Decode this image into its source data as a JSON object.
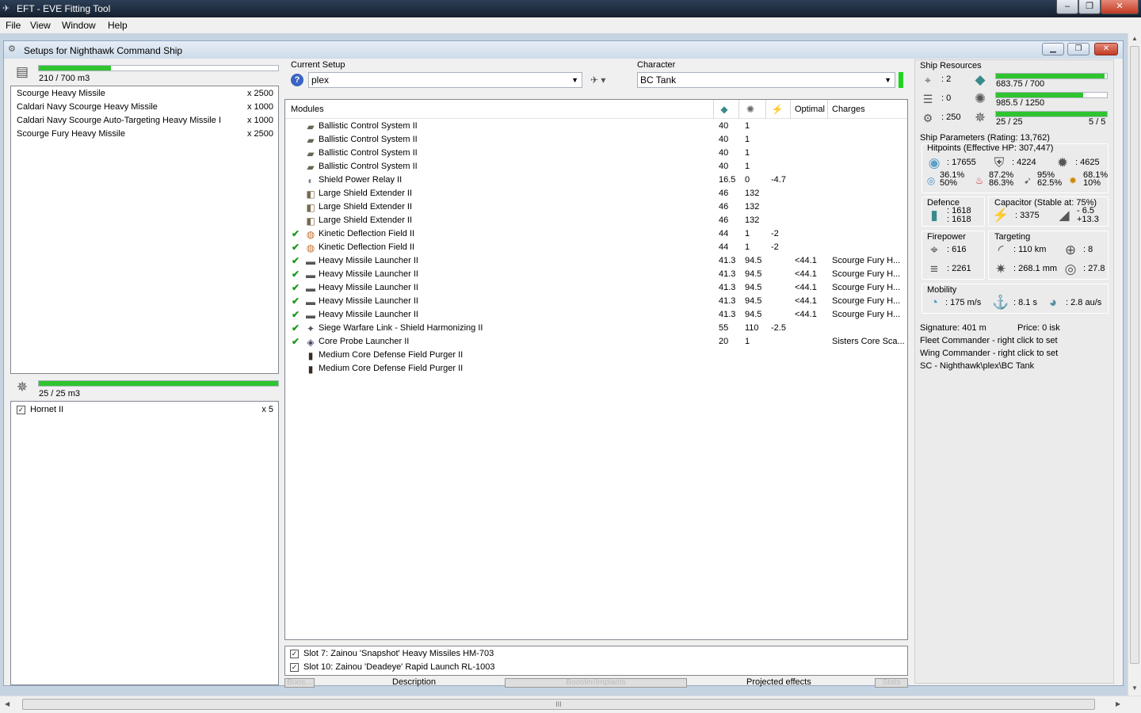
{
  "window": {
    "title": "EFT - EVE Fitting Tool",
    "minimize": "–",
    "maximize": "❐",
    "close": "✕"
  },
  "menu": [
    "File",
    "View",
    "Window",
    "Help"
  ],
  "inner": {
    "title": "Setups for Nighthawk Command Ship"
  },
  "cargo": {
    "capacity": "210 / 700 m3",
    "fill": 0.3,
    "items": [
      {
        "name": "Scourge Heavy Missile",
        "qty": "x 2500"
      },
      {
        "name": "Caldari Navy Scourge Heavy Missile",
        "qty": "x 1000"
      },
      {
        "name": "Caldari Navy Scourge Auto-Targeting Heavy Missile I",
        "qty": "x 1000"
      },
      {
        "name": "Scourge Fury Heavy Missile",
        "qty": "x 2500"
      }
    ]
  },
  "drones": {
    "capacity": "25 / 25 m3",
    "fill": 1.0,
    "items": [
      {
        "name": "Hornet II",
        "qty": "x 5"
      }
    ]
  },
  "setup": {
    "label": "Current Setup",
    "value": "plex"
  },
  "character": {
    "label": "Character",
    "value": "BC Tank"
  },
  "modules": {
    "headers": {
      "name": "Modules",
      "optimal": "Optimal",
      "charges": "Charges"
    },
    "rows": [
      {
        "active": false,
        "name": "Ballistic Control System II",
        "cpu": "40",
        "pg": "1",
        "cap": "",
        "optimal": "",
        "charge": "",
        "icon": "ballistic-icon"
      },
      {
        "active": false,
        "name": "Ballistic Control System II",
        "cpu": "40",
        "pg": "1",
        "cap": "",
        "optimal": "",
        "charge": "",
        "icon": "ballistic-icon"
      },
      {
        "active": false,
        "name": "Ballistic Control System II",
        "cpu": "40",
        "pg": "1",
        "cap": "",
        "optimal": "",
        "charge": "",
        "icon": "ballistic-icon"
      },
      {
        "active": false,
        "name": "Ballistic Control System II",
        "cpu": "40",
        "pg": "1",
        "cap": "",
        "optimal": "",
        "charge": "",
        "icon": "ballistic-icon"
      },
      {
        "active": false,
        "name": "Shield Power Relay II",
        "cpu": "16.5",
        "pg": "0",
        "cap": "-4.7",
        "optimal": "",
        "charge": "",
        "icon": "shield-relay-icon"
      },
      {
        "active": false,
        "name": "Large Shield Extender II",
        "cpu": "46",
        "pg": "132",
        "cap": "",
        "optimal": "",
        "charge": "",
        "icon": "shield-extender-icon"
      },
      {
        "active": false,
        "name": "Large Shield Extender II",
        "cpu": "46",
        "pg": "132",
        "cap": "",
        "optimal": "",
        "charge": "",
        "icon": "shield-extender-icon"
      },
      {
        "active": false,
        "name": "Large Shield Extender II",
        "cpu": "46",
        "pg": "132",
        "cap": "",
        "optimal": "",
        "charge": "",
        "icon": "shield-extender-icon"
      },
      {
        "active": true,
        "name": "Kinetic Deflection Field II",
        "cpu": "44",
        "pg": "1",
        "cap": "-2",
        "optimal": "",
        "charge": "",
        "icon": "deflection-field-icon"
      },
      {
        "active": true,
        "name": "Kinetic Deflection Field II",
        "cpu": "44",
        "pg": "1",
        "cap": "-2",
        "optimal": "",
        "charge": "",
        "icon": "deflection-field-icon"
      },
      {
        "active": true,
        "name": "Heavy Missile Launcher II",
        "cpu": "41.3",
        "pg": "94.5",
        "cap": "",
        "optimal": "<44.1",
        "charge": "Scourge Fury H...",
        "icon": "missile-launcher-icon"
      },
      {
        "active": true,
        "name": "Heavy Missile Launcher II",
        "cpu": "41.3",
        "pg": "94.5",
        "cap": "",
        "optimal": "<44.1",
        "charge": "Scourge Fury H...",
        "icon": "missile-launcher-icon"
      },
      {
        "active": true,
        "name": "Heavy Missile Launcher II",
        "cpu": "41.3",
        "pg": "94.5",
        "cap": "",
        "optimal": "<44.1",
        "charge": "Scourge Fury H...",
        "icon": "missile-launcher-icon"
      },
      {
        "active": true,
        "name": "Heavy Missile Launcher II",
        "cpu": "41.3",
        "pg": "94.5",
        "cap": "",
        "optimal": "<44.1",
        "charge": "Scourge Fury H...",
        "icon": "missile-launcher-icon"
      },
      {
        "active": true,
        "name": "Heavy Missile Launcher II",
        "cpu": "41.3",
        "pg": "94.5",
        "cap": "",
        "optimal": "<44.1",
        "charge": "Scourge Fury H...",
        "icon": "missile-launcher-icon"
      },
      {
        "active": true,
        "name": "Siege Warfare Link - Shield Harmonizing II",
        "cpu": "55",
        "pg": "110",
        "cap": "-2.5",
        "optimal": "",
        "charge": "",
        "icon": "warfare-link-icon"
      },
      {
        "active": true,
        "name": "Core Probe Launcher II",
        "cpu": "20",
        "pg": "1",
        "cap": "",
        "optimal": "",
        "charge": "Sisters Core Sca...",
        "icon": "probe-launcher-icon"
      },
      {
        "active": false,
        "name": "Medium Core Defense Field Purger II",
        "cpu": "",
        "pg": "",
        "cap": "",
        "optimal": "",
        "charge": "",
        "icon": "rig-icon"
      },
      {
        "active": false,
        "name": "Medium Core Defense Field Purger II",
        "cpu": "",
        "pg": "",
        "cap": "",
        "optimal": "",
        "charge": "",
        "icon": "rig-icon"
      }
    ]
  },
  "implants": [
    {
      "name": "Slot 7: Zainou 'Snapshot' Heavy Missiles HM-703",
      "checked": true
    },
    {
      "name": "Slot 10: Zainou 'Deadeye' Rapid Launch RL-1003",
      "checked": true
    }
  ],
  "bottom_tabs": {
    "boost": "Boos...",
    "description": "Description",
    "booster": "Booster/Implants",
    "projected": "Projected effects",
    "stats": "Stats"
  },
  "resources": {
    "title": "Ship Resources",
    "turrets": ": 2",
    "launchers": ": 0",
    "calibration": ": 250",
    "cpu": "683.75 / 700",
    "cpu_fill": 0.977,
    "power": "985.5 / 1250",
    "power_fill": 0.788,
    "drone_bw": "25 / 25",
    "drone_bw_fill": 1.0,
    "drones_active": "5 / 5"
  },
  "params": {
    "title": "Ship Parameters (Rating: 13,762)",
    "hp_title": "Hitpoints (Effective HP: 307,447)",
    "shield_hp": ": 17655",
    "armor_hp": ": 4224",
    "structure_hp": ": 4625",
    "res": [
      {
        "a": "36.1%",
        "b": "50%"
      },
      {
        "a": "87.2%",
        "b": "86.3%"
      },
      {
        "a": "95%",
        "b": "62.5%"
      },
      {
        "a": "68.1%",
        "b": "10%"
      }
    ],
    "defence_title": "Defence",
    "defence_a": ": 1618",
    "defence_b": ": 1618",
    "cap_title": "Capacitor (Stable at: 75%)",
    "cap_value": ": 3375",
    "cap_a": "- 6.5",
    "cap_b": "+13.3",
    "firepower_title": "Firepower",
    "dps": ": 616",
    "volley": ": 2261",
    "targeting_title": "Targeting",
    "range": ": 110 km",
    "targets": ": 8",
    "scan": ": 268.1 mm",
    "sig_radius": ": 27.8",
    "mobility_title": "Mobility",
    "speed": ": 175 m/s",
    "align": ": 8.1 s",
    "warp": ": 2.8 au/s",
    "signature": "Signature: 401 m",
    "price": "Price: 0 isk",
    "fleet": "Fleet Commander - right click to set",
    "wing": "Wing Commander - right click to set",
    "path": "SC - Nighthawk\\plex\\BC Tank"
  }
}
